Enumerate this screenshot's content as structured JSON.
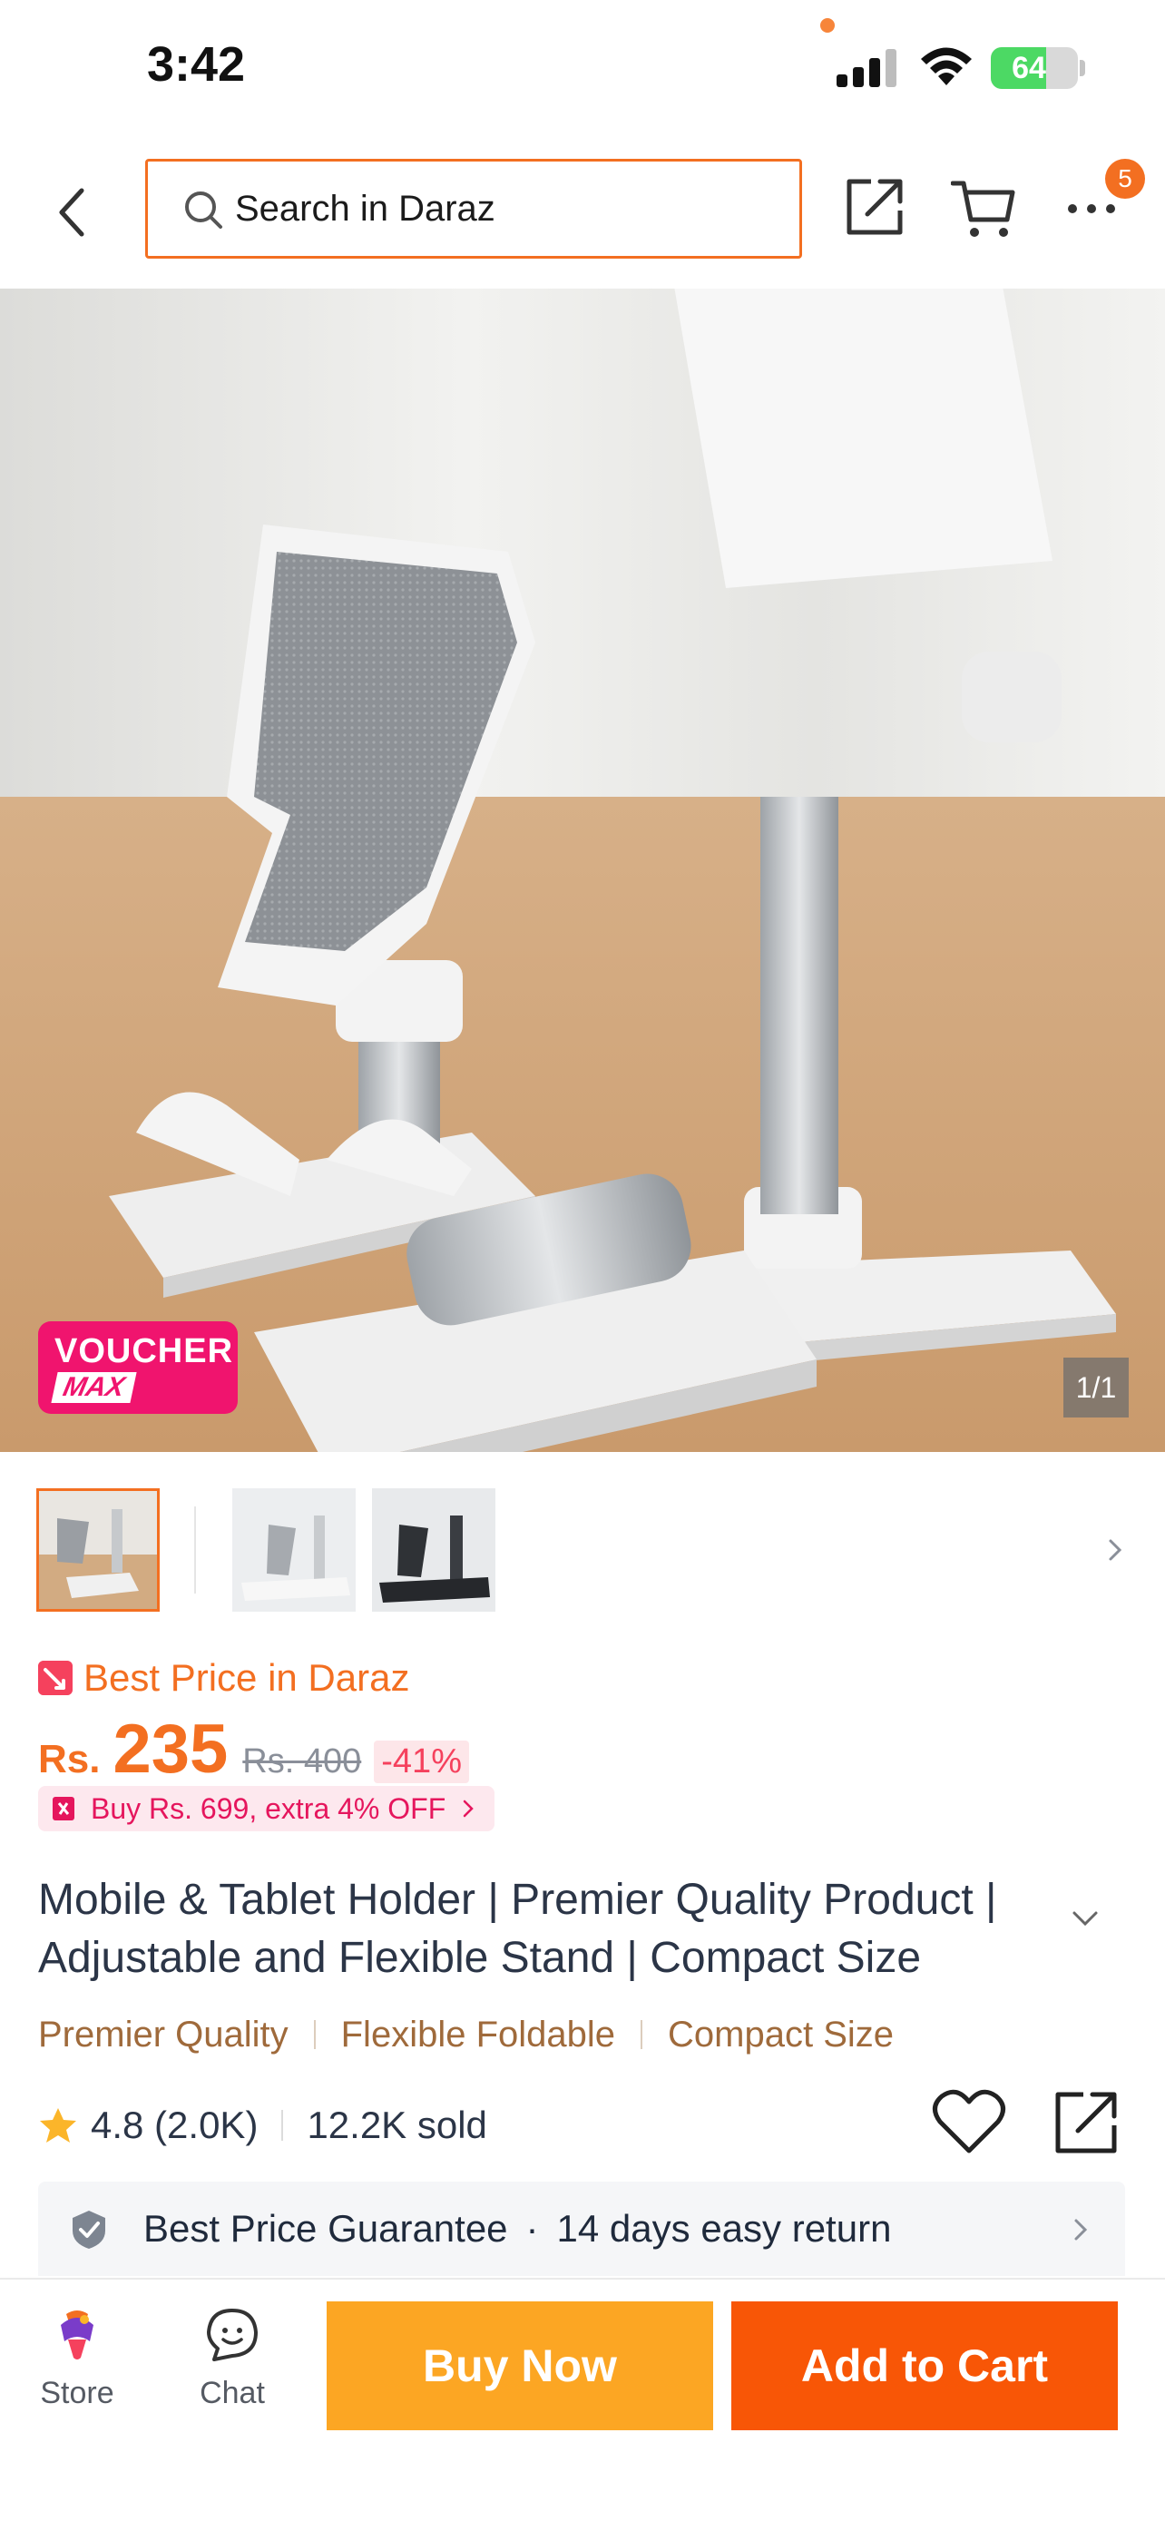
{
  "status_bar": {
    "time": "3:42",
    "battery_percent": "64",
    "battery_level": 0.64
  },
  "header": {
    "search_placeholder": "Search in Daraz",
    "cart_badge": "5",
    "icons": [
      "back-icon",
      "search-icon",
      "share-icon",
      "cart-icon",
      "more-icon"
    ]
  },
  "gallery": {
    "voucher_line1": "VOUCHER",
    "voucher_line2": "MAX",
    "counter": "1/1",
    "thumbnail_count": 3
  },
  "price": {
    "best_price_label": "Best Price in Daraz",
    "currency": "Rs.",
    "current": "235",
    "original": "Rs. 400",
    "discount": "-41%",
    "promo": "Buy Rs. 699, extra 4% OFF"
  },
  "product": {
    "title": "Mobile & Tablet Holder | Premier Quality Product | Adjustable and Flexible Stand | Compact Size",
    "tags": [
      "Premier Quality",
      "Flexible Foldable",
      "Compact Size"
    ],
    "rating": "4.8 (2.0K)",
    "sold": "12.2K sold"
  },
  "guarantee": {
    "item1": "Best Price Guarantee",
    "separator": "·",
    "item2": "14 days easy return"
  },
  "bottom_bar": {
    "store_label": "Store",
    "chat_label": "Chat",
    "buy_now_label": "Buy Now",
    "add_to_cart_label": "Add to Cart"
  },
  "colors": {
    "brand_orange": "#f36f21",
    "buy_now": "#fca623",
    "add_to_cart": "#f85606",
    "voucher_pink": "#f0146e",
    "tag_brown": "#9f6a3b"
  }
}
